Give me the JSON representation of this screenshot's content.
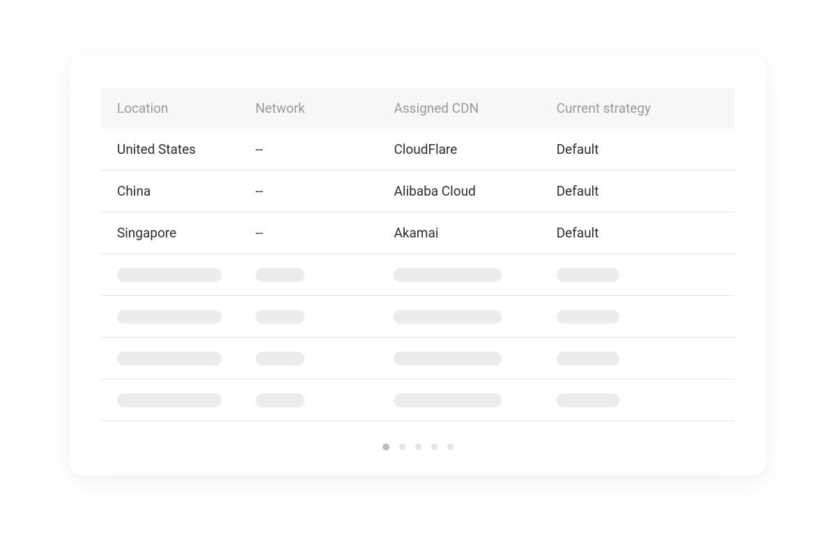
{
  "table": {
    "columns": {
      "location": "Location",
      "network": "Network",
      "cdn": "Assigned CDN",
      "strategy": "Current strategy"
    },
    "rows": [
      {
        "location": "United States",
        "network": "--",
        "cdn": "CloudFlare",
        "strategy": "Default"
      },
      {
        "location": "China",
        "network": "--",
        "cdn": "Alibaba Cloud",
        "strategy": "Default"
      },
      {
        "location": "Singapore",
        "network": "--",
        "cdn": "Akamai",
        "strategy": "Default"
      }
    ],
    "skeleton_row_count": 4
  },
  "pagination": {
    "page_count": 5,
    "active_index": 0
  }
}
